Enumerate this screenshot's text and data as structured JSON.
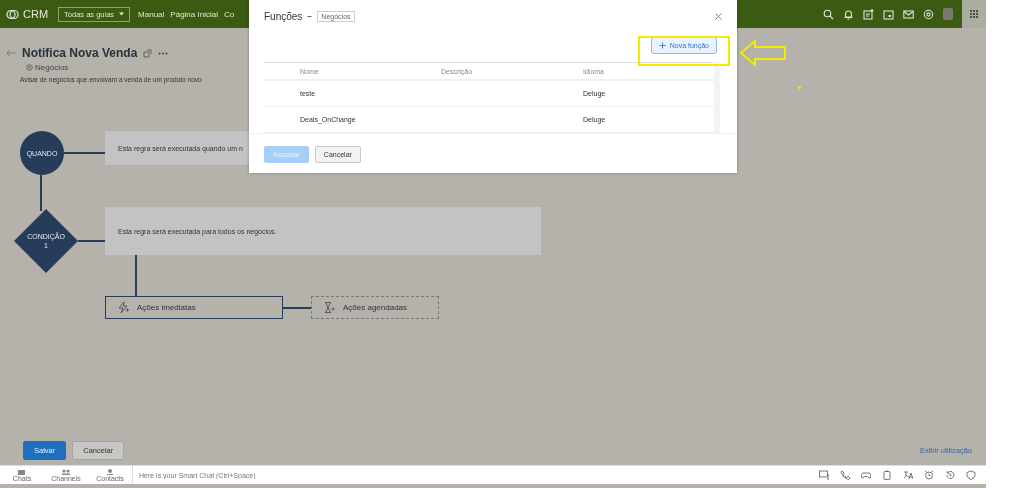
{
  "top_bar": {
    "logo": "CRM",
    "tabs_menu": "Todas as guias",
    "nav": [
      "Manual",
      "Página Inicial",
      "Co"
    ]
  },
  "record": {
    "title": "Notifica Nova Venda",
    "module": "Negócios",
    "description": "Avisar de negócios que envolvam a venda de um produto novo"
  },
  "flow": {
    "when": {
      "label": "QUANDO",
      "text": "Esta regra será executada quando um n"
    },
    "condition": {
      "label": "CONDIÇÃO 1",
      "text": "Esta regra será executada para todos os negócios."
    },
    "actions": [
      {
        "kind": "immediate",
        "label": "Ações imediatas"
      },
      {
        "kind": "scheduled",
        "label": "Ações agendadas"
      }
    ]
  },
  "footer": {
    "buttons": [
      {
        "label": "Salvar",
        "kind": "primary"
      },
      {
        "label": "Cancelar",
        "kind": "secondary"
      }
    ],
    "link": "Exibir utilização"
  },
  "chat_bar": {
    "tabs": [
      "Chats",
      "Channels",
      "Contacts"
    ],
    "placeholder": "Here is your Smart Chat (Ctrl+Space)"
  },
  "dialog": {
    "title": "Funções",
    "tag": "Negócios",
    "new_button": "Nova função",
    "table": {
      "columns": [
        "Nome",
        "Descrição",
        "Idioma"
      ],
      "rows": [
        [
          "teste",
          "",
          "Deluge"
        ],
        [
          "Deals_OnChange",
          "",
          "Deluge"
        ]
      ]
    },
    "buttons": [
      {
        "label": "Associar",
        "kind": "primary",
        "disabled": true
      },
      {
        "label": "Cancelar",
        "kind": "secondary",
        "disabled": false
      }
    ]
  }
}
